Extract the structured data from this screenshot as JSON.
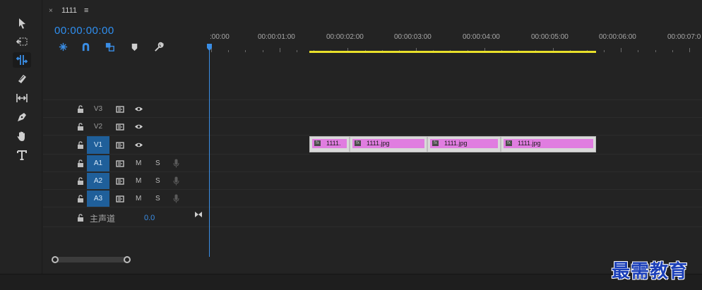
{
  "sequence_tab": {
    "close_glyph": "×",
    "name": "1111",
    "menu_glyph": "≡"
  },
  "timecode": "00:00:00:00",
  "ruler": {
    "labels": [
      ":00:00",
      "00:00:01:00",
      "00:00:02:00",
      "00:00:03:00",
      "00:00:04:00",
      "00:00:05:00",
      "00:00:06:00",
      "00:00:07:0"
    ],
    "work_area_color": "#e9e02a"
  },
  "tools": [
    "selection-tool-icon",
    "track-select-tool-icon",
    "ripple-edit-tool-icon",
    "razor-tool-icon",
    "slip-tool-icon",
    "pen-tool-icon",
    "hand-tool-icon",
    "type-tool-icon"
  ],
  "timeline_controls": [
    "snap-in-timeline-icon",
    "linked-selection-icon",
    "insert-sequence-as-nest-icon",
    "add-marker-icon",
    "timeline-settings-icon"
  ],
  "tracks": {
    "video": [
      {
        "label": "V3",
        "targeted": false
      },
      {
        "label": "V2",
        "targeted": false
      },
      {
        "label": "V1",
        "targeted": true
      }
    ],
    "audio": [
      {
        "label": "A1",
        "mute": "M",
        "solo": "S"
      },
      {
        "label": "A2",
        "mute": "M",
        "solo": "S"
      },
      {
        "label": "A3",
        "mute": "M",
        "solo": "S"
      }
    ],
    "master": {
      "label": "主声道",
      "value": "0.0"
    }
  },
  "clips": [
    {
      "name": "1111."
    },
    {
      "name": "1111.jpg"
    },
    {
      "name": "1111.jpg"
    },
    {
      "name": "1111.jpg"
    }
  ],
  "clip_fx_label": "fx",
  "colors": {
    "accent": "#2f8ff0",
    "clip": "#e07de0",
    "track_target": "#1f5f9a"
  },
  "watermark": "最需教育"
}
